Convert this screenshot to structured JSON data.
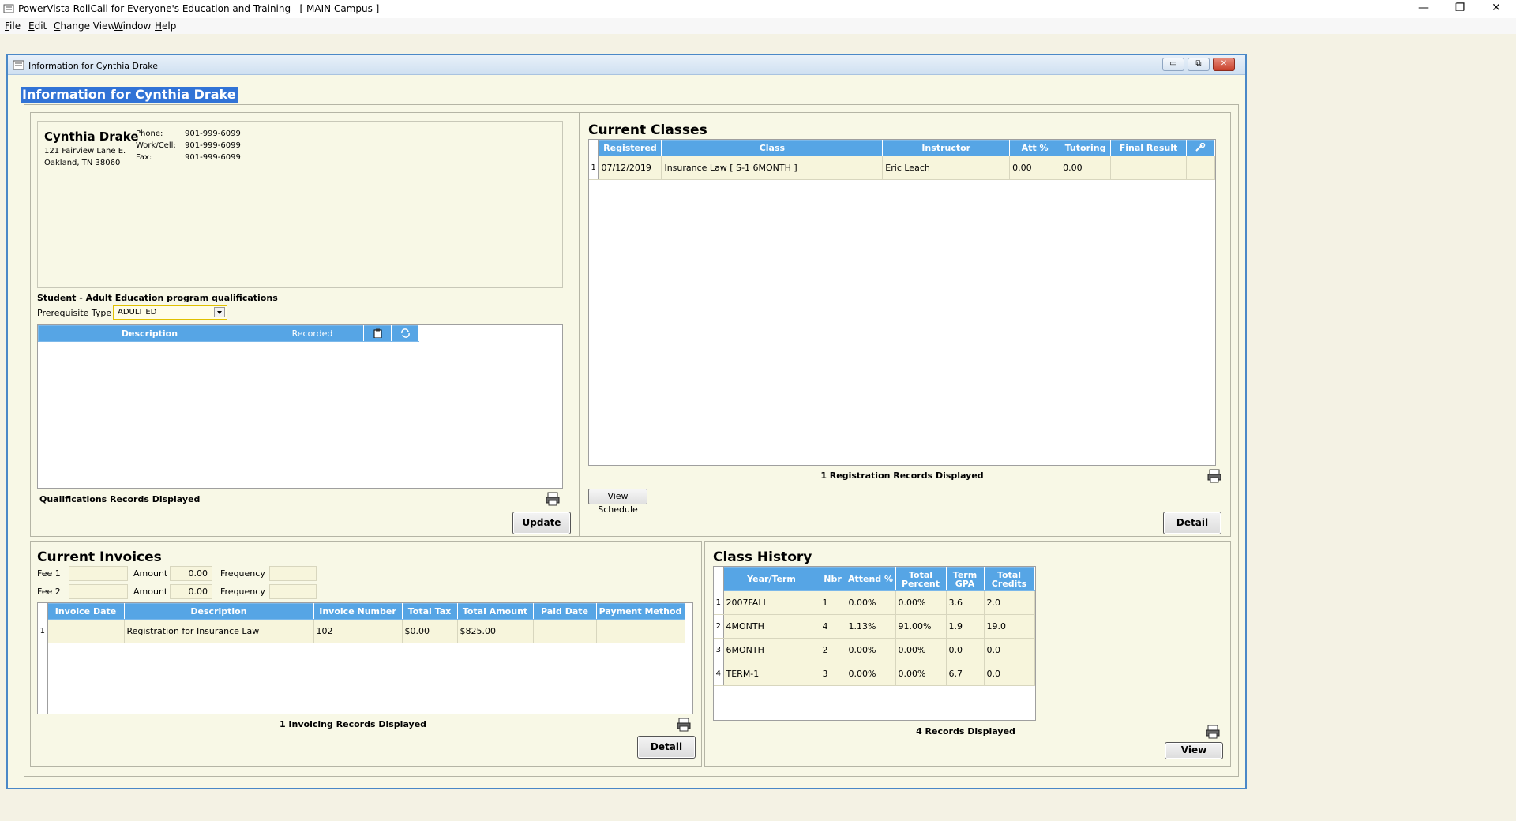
{
  "app": {
    "title": "PowerVista RollCall for Everyone's Education and Training   [ MAIN Campus ]",
    "window_controls": {
      "minimize": "—",
      "restore": "❐",
      "close": "✕"
    },
    "menu": [
      {
        "ul": "F",
        "rest": "ile"
      },
      {
        "ul": "E",
        "rest": "dit"
      },
      {
        "ul": "C",
        "rest": "hange View"
      },
      {
        "ul": "W",
        "rest": "indow"
      },
      {
        "ul": "H",
        "rest": "elp"
      }
    ]
  },
  "window": {
    "title": "Information for Cynthia Drake",
    "heading": "Information for Cynthia Drake",
    "controls": {
      "minimize": "▭",
      "restore": "⧉",
      "close": "✕"
    }
  },
  "contact": {
    "name": "Cynthia Drake",
    "address1": "121 Fairview Lane E.",
    "address2": "Oakland, TN 38060",
    "phone_label": "Phone:",
    "phone": "901-999-6099",
    "cell_label": "Work/Cell:",
    "cell": "901-999-6099",
    "fax_label": "Fax:",
    "fax": "901-999-6099"
  },
  "qualifications": {
    "title": "Student - Adult Education program qualifications",
    "prereq_label": "Prerequisite Type",
    "prereq_value": "ADULT ED",
    "columns": [
      "Description",
      "Recorded"
    ],
    "status": "Qualifications Records Displayed",
    "update_button": "Update"
  },
  "current_classes": {
    "title": "Current Classes",
    "columns": [
      "Registered",
      "Class",
      "Instructor",
      "Att %",
      "Tutoring",
      "Final Result"
    ],
    "rows": [
      {
        "n": "1",
        "registered": "07/12/2019",
        "class": "Insurance Law [ S-1 6MONTH ]",
        "instructor": "Eric Leach",
        "att": "0.00",
        "tutoring": "0.00",
        "final": ""
      }
    ],
    "status": "1 Registration Records Displayed",
    "view_schedule_button": "View Schedule",
    "detail_button": "Detail"
  },
  "current_invoices": {
    "title": "Current Invoices",
    "fee1_label": "Fee 1",
    "fee2_label": "Fee 2",
    "amount_label": "Amount",
    "frequency_label": "Frequency",
    "fee1_amount": "0.00",
    "fee2_amount": "0.00",
    "columns": [
      "Invoice Date",
      "Description",
      "Invoice Number",
      "Total Tax",
      "Total Amount",
      "Paid Date",
      "Payment Method"
    ],
    "rows": [
      {
        "n": "1",
        "date": "",
        "description": "Registration for Insurance Law",
        "number": "102",
        "tax": "$0.00",
        "amount": "$825.00",
        "paid": "",
        "method": ""
      }
    ],
    "status": "1 Invoicing Records Displayed",
    "detail_button": "Detail"
  },
  "class_history": {
    "title": "Class History",
    "columns": [
      "Year/Term",
      "Nbr",
      "Attend %",
      "Total Percent",
      "Term GPA",
      "Total Credits"
    ],
    "rows": [
      {
        "n": "1",
        "term": "2007FALL",
        "nbr": "1",
        "attend": "0.00%",
        "percent": "0.00%",
        "gpa": "3.6",
        "credits": "2.0"
      },
      {
        "n": "2",
        "term": "4MONTH",
        "nbr": "4",
        "attend": "1.13%",
        "percent": "91.00%",
        "gpa": "1.9",
        "credits": "19.0"
      },
      {
        "n": "3",
        "term": "6MONTH",
        "nbr": "2",
        "attend": "0.00%",
        "percent": "0.00%",
        "gpa": "0.0",
        "credits": "0.0"
      },
      {
        "n": "4",
        "term": "TERM-1",
        "nbr": "3",
        "attend": "0.00%",
        "percent": "0.00%",
        "gpa": "6.7",
        "credits": "0.0"
      }
    ],
    "status": "4 Records Displayed",
    "view_button": "View"
  },
  "colors": {
    "header_blue": "#56a5e5",
    "row_cream": "#f7f5dc",
    "selection_blue": "#3173d6",
    "window_border": "#4a88c7"
  },
  "icons": [
    "app-icon",
    "window-icon",
    "print-icon",
    "dropdown-arrow-icon",
    "clipboard-icon",
    "refresh-icon",
    "settings-icon"
  ]
}
